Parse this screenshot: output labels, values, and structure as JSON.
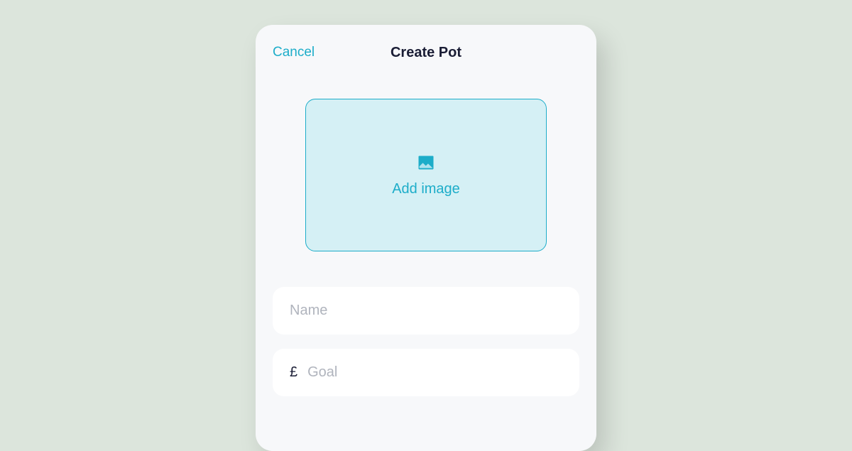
{
  "header": {
    "cancel_label": "Cancel",
    "title": "Create Pot"
  },
  "image_upload": {
    "label": "Add image"
  },
  "fields": {
    "name": {
      "placeholder": "Name",
      "value": ""
    },
    "goal": {
      "currency_symbol": "£",
      "placeholder": "Goal",
      "value": ""
    }
  },
  "colors": {
    "accent": "#1dadc9",
    "upload_bg": "#d5f0f5",
    "page_bg": "#dce5dc",
    "modal_bg": "#f7f8fa",
    "input_bg": "#ffffff",
    "text_primary": "#1a1d35",
    "placeholder": "#b0b4bd"
  }
}
